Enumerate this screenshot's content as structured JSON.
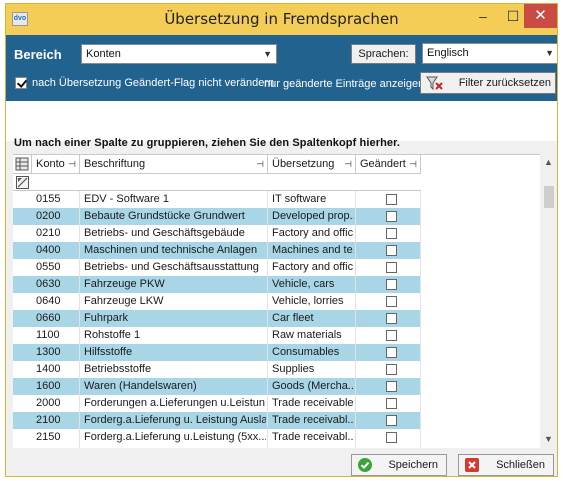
{
  "window": {
    "title": "Übersetzung in Fremdsprachen",
    "icon_text": "dvo",
    "controls": {
      "minimize": "–",
      "maximize": "☐",
      "close": "✕"
    }
  },
  "toolbar": {
    "bereich_label": "Bereich",
    "bereich_value": "Konten",
    "sprachen_button": "Sprachen:",
    "sprache_value": "Englisch",
    "keep_flag_checked": true,
    "keep_flag_label": "nach Übersetzung Geändert-Flag nicht verändern",
    "only_changed_label": "nur geänderte Einträge anzeigen",
    "filter_reset_button": "Filter zurücksetzen"
  },
  "group_panel": {
    "hint": "Um nach einer Spalte zu gruppieren, ziehen Sie den Spaltenkopf hierher."
  },
  "grid": {
    "columns": [
      "Konto",
      "Beschriftung",
      "Übersetzung",
      "Geändert"
    ],
    "pin_glyph": "⊣",
    "rows": [
      {
        "konto": "0155",
        "beschriftung": "EDV - Software 1",
        "uebersetzung": "IT software",
        "geaendert": false
      },
      {
        "konto": "0200",
        "beschriftung": "Bebaute Grundstücke Grundwert",
        "uebersetzung": "Developed prop...",
        "geaendert": false
      },
      {
        "konto": "0210",
        "beschriftung": "Betriebs- und Geschäftsgebäude",
        "uebersetzung": "Factory and offic...",
        "geaendert": false
      },
      {
        "konto": "0400",
        "beschriftung": "Maschinen und technische Anlagen",
        "uebersetzung": "Machines and te...",
        "geaendert": false
      },
      {
        "konto": "0550",
        "beschriftung": "Betriebs- und Geschäftsausstattung",
        "uebersetzung": "Factory and offic...",
        "geaendert": false
      },
      {
        "konto": "0630",
        "beschriftung": "Fahrzeuge PKW",
        "uebersetzung": "Vehicle, cars",
        "geaendert": false
      },
      {
        "konto": "0640",
        "beschriftung": "Fahrzeuge LKW",
        "uebersetzung": "Vehicle, lorries",
        "geaendert": false
      },
      {
        "konto": "0660",
        "beschriftung": "Fuhrpark",
        "uebersetzung": "Car fleet",
        "geaendert": false
      },
      {
        "konto": "1100",
        "beschriftung": "Rohstoffe 1",
        "uebersetzung": "Raw materials",
        "geaendert": false
      },
      {
        "konto": "1300",
        "beschriftung": "Hilfsstoffe",
        "uebersetzung": "Consumables",
        "geaendert": false
      },
      {
        "konto": "1400",
        "beschriftung": "Betriebsstoffe",
        "uebersetzung": "Supplies",
        "geaendert": false
      },
      {
        "konto": "1600",
        "beschriftung": "Waren (Handelswaren)",
        "uebersetzung": "Goods (Mercha...",
        "geaendert": false
      },
      {
        "konto": "2000",
        "beschriftung": "Forderungen a.Lieferungen u.Leistun...",
        "uebersetzung": "Trade receivables",
        "geaendert": false
      },
      {
        "konto": "2100",
        "beschriftung": "Forderg.a.Lieferung u. Leistung Ausla...",
        "uebersetzung": "Trade receivabl...",
        "geaendert": false
      },
      {
        "konto": "2150",
        "beschriftung": "Forderg.a.Lieferung u.Leistung (5xx...",
        "uebersetzung": "Trade receivabl...",
        "geaendert": false
      }
    ]
  },
  "footer": {
    "save_button": "Speichern",
    "close_button": "Schließen"
  },
  "colors": {
    "title_bar": "#f3cd55",
    "toolbar": "#22628f",
    "alt_row": "#a9d6e6",
    "close_button": "#c94b43"
  }
}
